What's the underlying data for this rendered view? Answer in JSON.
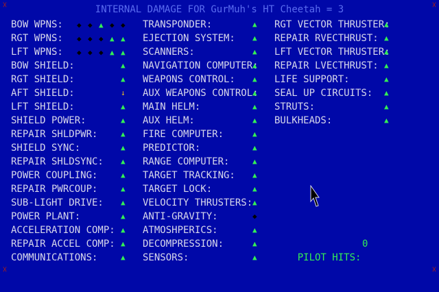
{
  "title": "INTERNAL DAMAGE FOR GurMuh's HT Cheetah = 3",
  "glyphs": {
    "ok": "▲",
    "dead": "◆",
    "damaged": "↓",
    "corner": "☓"
  },
  "weapons": [
    {
      "label": "BOW WPNS:",
      "pips": [
        "dead",
        "dead",
        "ok",
        "dead",
        "dead"
      ]
    },
    {
      "label": "RGT WPNS:",
      "pips": [
        "dead",
        "dead",
        "dead",
        "ok",
        "ok"
      ]
    },
    {
      "label": "LFT WPNS:",
      "pips": [
        "dead",
        "dead",
        "dead",
        "ok",
        "ok"
      ]
    }
  ],
  "col1": [
    {
      "label": "BOW SHIELD:",
      "status": "ok"
    },
    {
      "label": "RGT SHIELD:",
      "status": "ok"
    },
    {
      "label": "AFT SHIELD:",
      "status": "damaged"
    },
    {
      "label": "LFT SHIELD:",
      "status": "ok"
    },
    {
      "label": "SHIELD POWER:",
      "status": "ok"
    },
    {
      "label": "REPAIR SHLDPWR:",
      "status": "ok"
    },
    {
      "label": "SHIELD SYNC:",
      "status": "ok"
    },
    {
      "label": "REPAIR SHLDSYNC:",
      "status": "ok"
    },
    {
      "label": "POWER COUPLING:",
      "status": "ok"
    },
    {
      "label": "REPAIR PWRCOUP:",
      "status": "ok"
    },
    {
      "label": "SUB-LIGHT DRIVE:",
      "status": "ok"
    },
    {
      "label": "POWER PLANT:",
      "status": "ok"
    },
    {
      "label": "ACCELERATION COMP:",
      "status": "ok"
    },
    {
      "label": "REPAIR ACCEL COMP:",
      "status": "ok"
    },
    {
      "label": "COMMUNICATIONS:",
      "status": "ok"
    }
  ],
  "col2": [
    {
      "label": "TRANSPONDER:",
      "status": "ok"
    },
    {
      "label": "EJECTION SYSTEM:",
      "status": "ok"
    },
    {
      "label": "SCANNERS:",
      "status": "ok"
    },
    {
      "label": "NAVIGATION COMPUTER:",
      "status": "ok"
    },
    {
      "label": "WEAPONS CONTROL:",
      "status": "ok"
    },
    {
      "label": "AUX WEAPONS CONTROL:",
      "status": "ok"
    },
    {
      "label": "MAIN HELM:",
      "status": "ok"
    },
    {
      "label": "AUX HELM:",
      "status": "ok"
    },
    {
      "label": "FIRE COMPUTER:",
      "status": "ok"
    },
    {
      "label": "PREDICTOR:",
      "status": "ok"
    },
    {
      "label": "RANGE COMPUTER:",
      "status": "ok"
    },
    {
      "label": "TARGET TRACKING:",
      "status": "ok"
    },
    {
      "label": "TARGET LOCK:",
      "status": "ok"
    },
    {
      "label": "VELOCITY THRUSTERS:",
      "status": "ok"
    },
    {
      "label": "ANTI-GRAVITY:",
      "status": "dead"
    },
    {
      "label": "ATMOSHPERICS:",
      "status": "ok"
    },
    {
      "label": "DECOMPRESSION:",
      "status": "ok"
    },
    {
      "label": "SENSORS:",
      "status": "ok"
    }
  ],
  "col3": [
    {
      "label": "RGT VECTOR THRUSTER:",
      "status": "ok"
    },
    {
      "label": "REPAIR RVECTHRUST:",
      "status": "ok"
    },
    {
      "label": "LFT VECTOR THRUSTER:",
      "status": "ok"
    },
    {
      "label": "REPAIR LVECTHRUST:",
      "status": "ok"
    },
    {
      "label": "LIFE SUPPORT:",
      "status": "ok"
    },
    {
      "label": "SEAL UP CIRCUITS:",
      "status": "ok"
    },
    {
      "label": "STRUTS:",
      "status": "ok"
    },
    {
      "label": "BULKHEADS:",
      "status": "ok"
    }
  ],
  "pilot": {
    "label": "PILOT HITS:",
    "value": "0"
  },
  "colors": {
    "background": "#0008a8",
    "title": "#5a6cf0",
    "label": "#d8d8ec",
    "ok": "#33ee55",
    "damaged": "#f0c020",
    "dead": "#000000",
    "corner": "#b02010"
  }
}
